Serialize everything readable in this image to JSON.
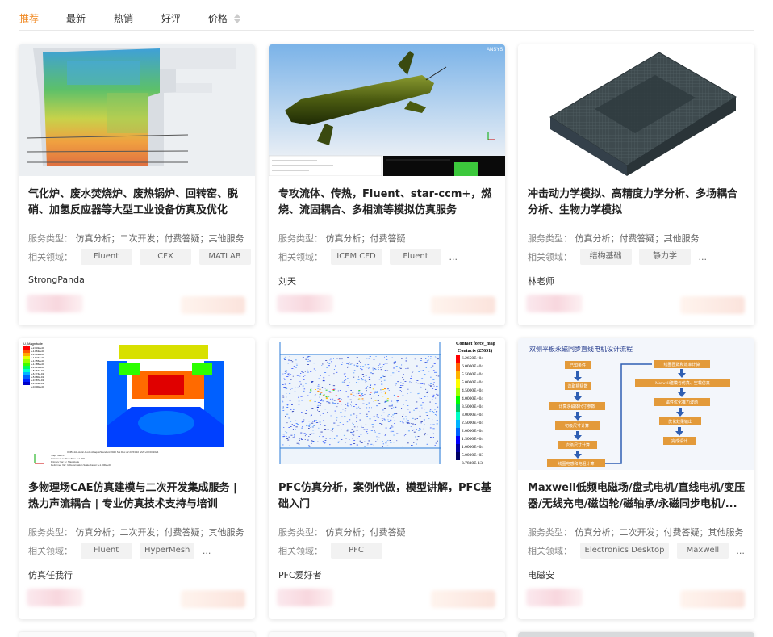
{
  "sort_tabs": [
    {
      "label": "推荐",
      "active": true
    },
    {
      "label": "最新",
      "active": false
    },
    {
      "label": "热销",
      "active": false
    },
    {
      "label": "好评",
      "active": false
    },
    {
      "label": "价格",
      "active": false
    }
  ],
  "labels": {
    "service_type": "服务类型：",
    "related_field": "相关领域："
  },
  "accent_color": "#f08a24",
  "cards": [
    {
      "title": "气化炉、废水焚烧炉、废热锅炉、回转窑、脱硝、加氢反应器等大型工业设备仿真及优化",
      "service_types": "仿真分析；二次开发；付费答疑；其他服务",
      "fields": [
        "Fluent",
        "CFX",
        "MATLAB"
      ],
      "ellipsis": "",
      "author": "StrongPanda",
      "image": "cfd-furnace-contour"
    },
    {
      "title": "专攻流体、传热，Fluent、star-ccm+，燃烧、流固耦合、多相流等模拟仿真服务",
      "service_types": "仿真分析；付费答疑",
      "fields": [
        "ICEM CFD",
        "Fluent"
      ],
      "ellipsis": "...",
      "author": "刘天",
      "image": "missile-ansys-model"
    },
    {
      "title": "冲击动力学模拟、高精度力学分析、多场耦合分析、生物力学模拟",
      "service_types": "仿真分析；付费答疑；其他服务",
      "fields": [
        "结构基础",
        "静力学"
      ],
      "ellipsis": "...",
      "author": "林老师",
      "image": "plate-mesh"
    },
    {
      "title": "多物理场CAE仿真建模与二次开发集成服务 | 热力声流耦合 | 专业仿真技术支持与培训",
      "service_types": "仿真分析；二次开发；付费答疑；其他服务",
      "fields": [
        "Fluent",
        "HyperMesh"
      ],
      "ellipsis": "...",
      "author": "仿真任我行",
      "image": "abaqus-stress-contour"
    },
    {
      "title": "PFC仿真分析，案例代做，模型讲解，PFC基础入门",
      "service_types": "仿真分析；付费答疑",
      "fields": [
        "PFC"
      ],
      "ellipsis": "",
      "author": "PFC爱好者",
      "image": "pfc-contact-force"
    },
    {
      "title": "Maxwell低频电磁场/盘式电机/直线电机/变压器/无线充电/磁齿轮/磁轴承/永磁同步电机/...",
      "service_types": "仿真分析；二次开发；付费答疑；其他服务",
      "fields": [
        "Electronics Desktop",
        "Maxwell"
      ],
      "ellipsis": "...",
      "author": "电磁安",
      "image": "maxwell-flowchart"
    }
  ],
  "thumbs": {
    "missile": {
      "watermark": "ANSYS"
    },
    "abaqus": {
      "legend_title": "U, Magnitude",
      "legend_values": [
        "+2.032e+00",
        "+1.863e+00",
        "+1.693e+00",
        "+1.524e+00",
        "+1.355e+00",
        "+1.185e+00",
        "+1.016e+00",
        "+8.467e-01",
        "+6.774e-01",
        "+5.080e-01",
        "+3.387e-01",
        "+1.693e-01",
        "+0.000e+00"
      ],
      "footer_line1": "ODB: Job-static-1.odb   Abaqus/Standard 2020   Sat Dec 22 23:53:10 GMT+08:00 2024",
      "footer_line2": "Step: Step-1",
      "footer_line3": "Increment 1: Step Time = 1.000",
      "footer_line4": "Primary Var: U, Magnitude",
      "footer_line5": "Deformed Var: U   Deformation Scale Factor: +1.000e+00"
    },
    "pfc": {
      "legend_title": "Contact force_mag",
      "legend_subtitle": "Contacts (25651)",
      "legend_values": [
        "6.2650E+04",
        "6.0000E+04",
        "5.5000E+04",
        "5.0000E+04",
        "4.5000E+04",
        "4.0000E+04",
        "3.5000E+04",
        "3.0000E+04",
        "2.5000E+04",
        "2.0000E+04",
        "1.5000E+04",
        "1.0000E+04",
        "5.0000E+03",
        "3.7830E-13"
      ]
    },
    "maxwell": {
      "title": "双侧平板永磁同步直线电机设计流程",
      "left_steps": [
        "已知条件",
        "选取槽极数",
        "计算永磁体尺寸参数",
        "初级尺寸计算",
        "次级尺寸计算",
        "线圈电感和电阻计算"
      ],
      "right_steps": [
        "线圈匝数和效率计算",
        "Maxwell建模与仿真、空载仿真",
        "磁性优化推力波动",
        "优化效果输出",
        "完成设计"
      ]
    }
  }
}
